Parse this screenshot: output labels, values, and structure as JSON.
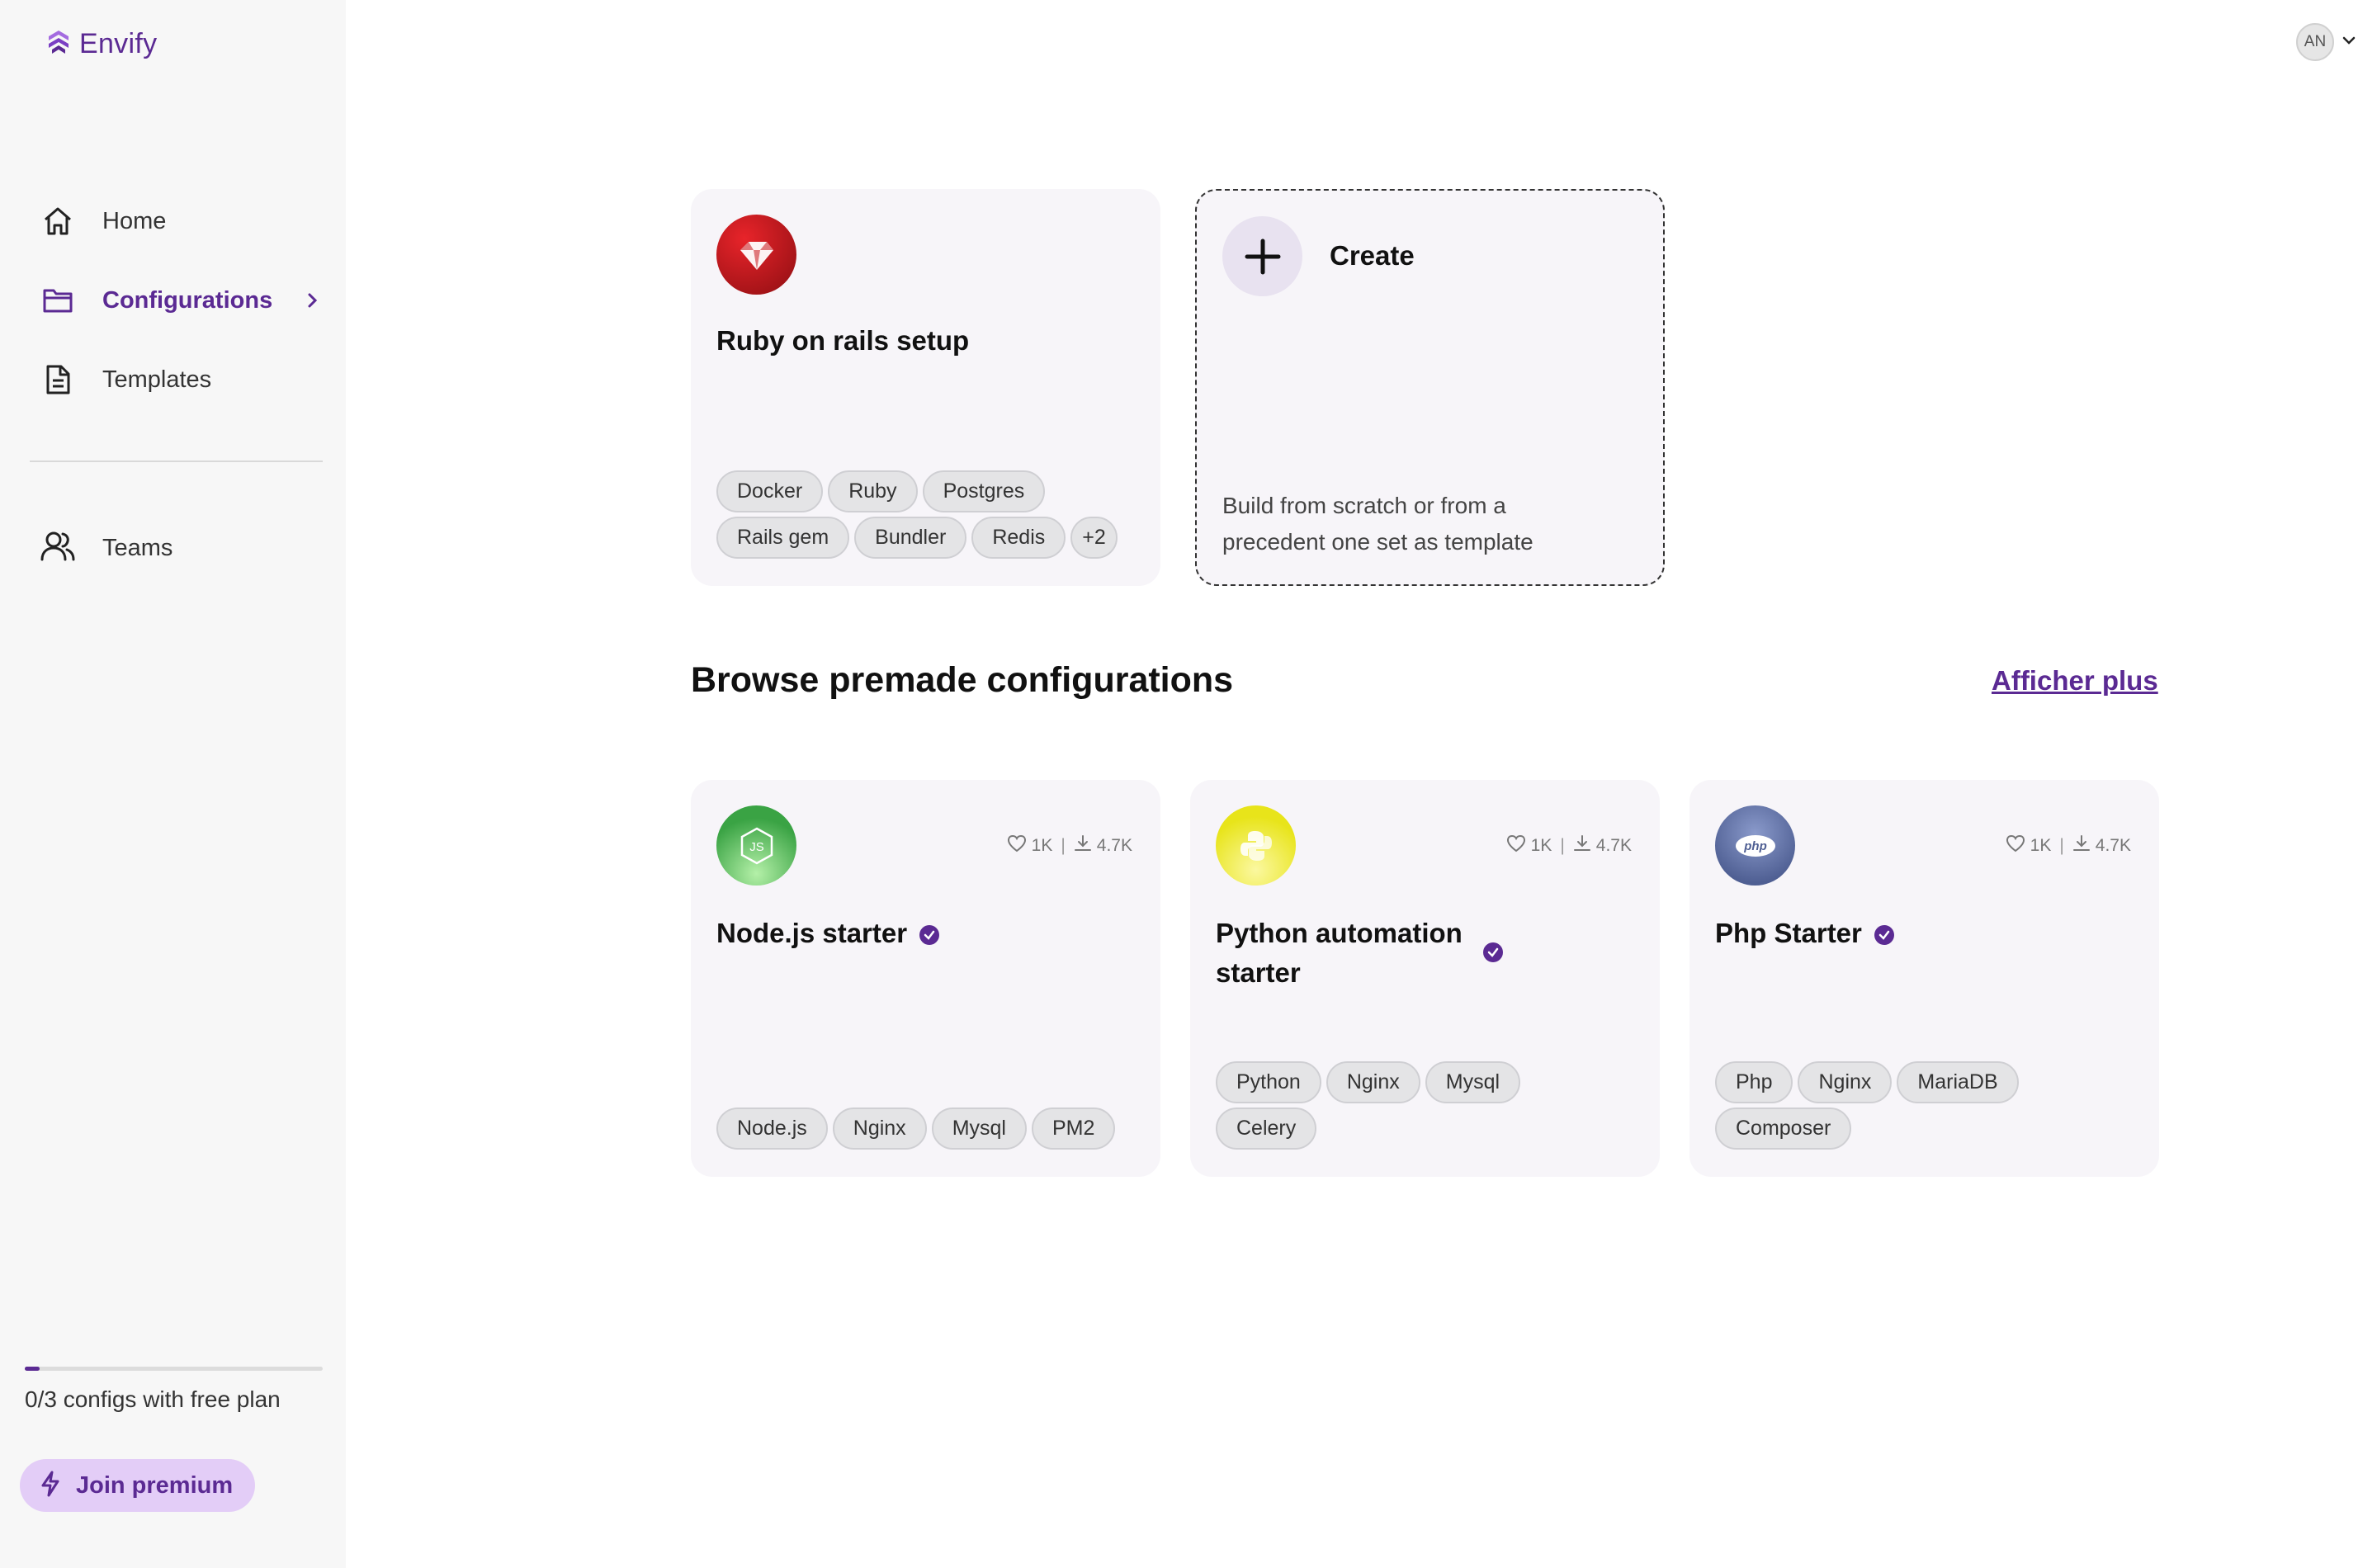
{
  "app": {
    "name": "Envify"
  },
  "sidebar": {
    "items": [
      {
        "label": "Home",
        "icon": "home-icon"
      },
      {
        "label": "Configurations",
        "icon": "folder-icon",
        "active": true
      },
      {
        "label": "Templates",
        "icon": "document-icon"
      }
    ],
    "teams_label": "Teams",
    "plan": {
      "text": "0/3 configs with free plan",
      "progress": 0.05
    },
    "premium_label": "Join premium"
  },
  "header": {
    "avatar_initials": "AN"
  },
  "my_config": {
    "title": "Ruby on rails setup",
    "icon": "ruby-icon",
    "tags": [
      "Docker",
      "Ruby",
      "Postgres",
      "Rails gem",
      "Bundler",
      "Redis"
    ],
    "more_tag": "+2"
  },
  "create_card": {
    "title": "Create",
    "description": "Build from scratch or from a precedent one set as template"
  },
  "browse": {
    "title": "Browse premade configurations",
    "see_more": "Afficher plus",
    "cards": [
      {
        "title": "Node.js starter",
        "icon": "nodejs-icon",
        "likes": "1K",
        "downloads": "4.7K",
        "tags": [
          "Node.js",
          "Nginx",
          "Mysql",
          "PM2"
        ]
      },
      {
        "title": "Python automation starter",
        "icon": "python-icon",
        "likes": "1K",
        "downloads": "4.7K",
        "tags": [
          "Python",
          "Nginx",
          "Mysql",
          "Celery"
        ]
      },
      {
        "title": "Php Starter",
        "icon": "php-icon",
        "likes": "1K",
        "downloads": "4.7K",
        "tags": [
          "Php",
          "Nginx",
          "MariaDB",
          "Composer"
        ]
      }
    ]
  },
  "colors": {
    "brand": "#5b2a93",
    "premium_bg": "#e3cdf7",
    "card_bg": "#f7f5f9"
  }
}
